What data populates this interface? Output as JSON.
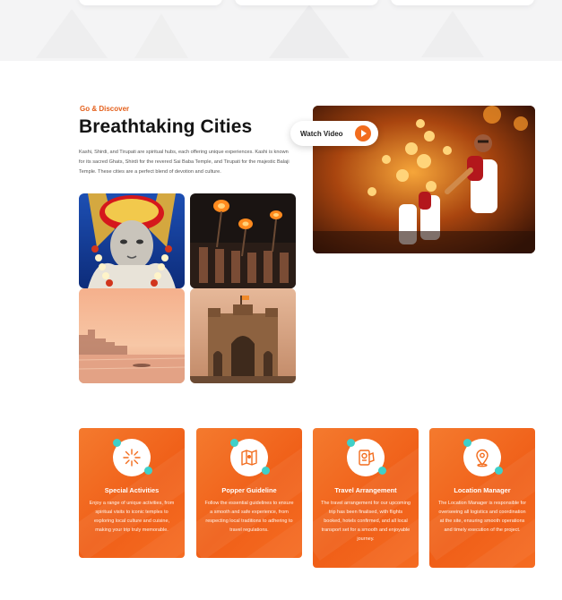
{
  "section": {
    "eyebrow": "Go & Discover",
    "title": "Breathtaking Cities",
    "description": "Kashi, Shirdi, and Tirupati are spiritual hubs, each offering unique experiences. Kashi is known for its sacred Ghats, Shirdi for the revered Sai Baba Temple, and Tirupati for the majestic Balaji Temple. These cities are a perfect blend of devotion and culture."
  },
  "gallery": [
    {
      "image": "sai-baba-idol"
    },
    {
      "image": "ganga-aarti-fire"
    },
    {
      "image": "varanasi-ghats-sunset"
    },
    {
      "image": "gateway-of-india"
    }
  ],
  "hero": {
    "image": "evening-aarti-priests",
    "watch_label": "Watch Video"
  },
  "services": [
    {
      "icon": "fireworks-icon",
      "title": "Special Activities",
      "text": "Enjoy a range of unique activities, from spiritual visits to iconic temples to exploring local culture and cuisine, making your trip truly memorable."
    },
    {
      "icon": "guide-map-icon",
      "title": "Popper Guideline",
      "text": "Follow the essential guidelines to ensure a smooth and safe experience, from respecting local traditions to adhering to travel regulations."
    },
    {
      "icon": "passport-ticket-icon",
      "title": "Travel Arrangement",
      "text": "The travel arrangement for our upcoming trip has been finalised, with flights booked, hotels confirmed, and all local transport set for a smooth and enjoyable journey."
    },
    {
      "icon": "location-pin-icon",
      "title": "Location Manager",
      "text": "The Location Manager is responsible for overseeing all logistics and coordination at the site, ensuring smooth operations and timely execution of the project."
    }
  ],
  "colors": {
    "accent": "#f26c1d",
    "teal": "#3fd0c9",
    "heading": "#141414"
  }
}
